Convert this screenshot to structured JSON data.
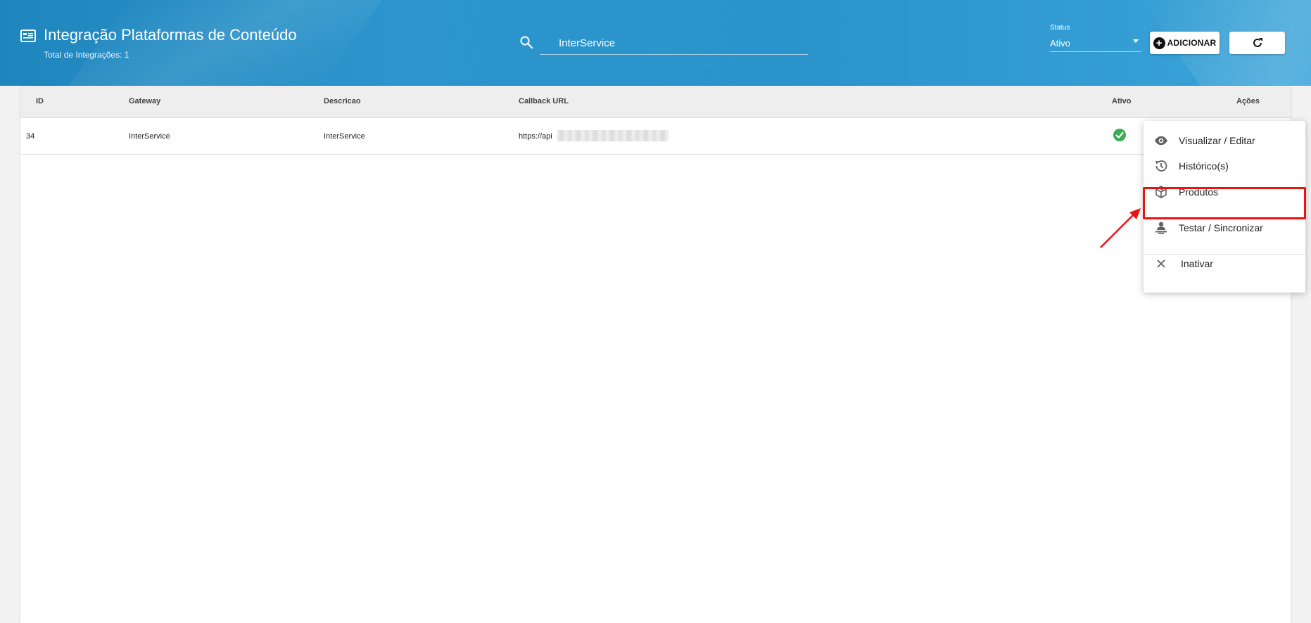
{
  "header": {
    "title": "Integração Plataformas de Conteúdo",
    "subtitle": "Total de Integrações: 1",
    "title_icon": "integration-list-icon"
  },
  "search": {
    "value": "InterService",
    "icon": "search-icon"
  },
  "status_filter": {
    "label": "Status",
    "selected": "Ativo"
  },
  "buttons": {
    "add_label": "ADICIONAR",
    "refresh_icon": "refresh-icon"
  },
  "table": {
    "columns": [
      "ID",
      "Gateway",
      "Descricao",
      "Callback URL",
      "Ativo",
      "Ações"
    ],
    "rows": [
      {
        "id": "34",
        "gateway": "InterService",
        "descricao": "InterService",
        "callback_url": "https://api",
        "ativo": true
      }
    ]
  },
  "actions_menu": {
    "items": [
      {
        "label": "Visualizar / Editar",
        "icon": "eye-icon"
      },
      {
        "label": "Histórico(s)",
        "icon": "history-icon"
      },
      {
        "label": "Produtos",
        "icon": "package-icon"
      },
      {
        "label": "Testar / Sincronizar",
        "icon": "person-sync-icon"
      },
      {
        "label": "Inativar",
        "icon": "close-icon"
      }
    ]
  },
  "colors": {
    "header_blue": "#2a91c8",
    "active_green": "#3bab55",
    "highlight_red": "#ee1111"
  }
}
